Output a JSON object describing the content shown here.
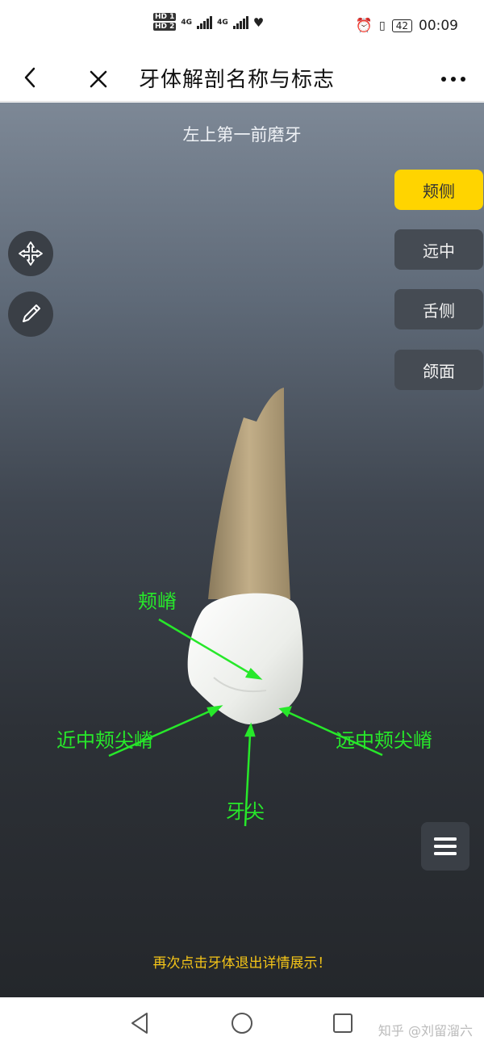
{
  "status_bar": {
    "hd1": "HD 1",
    "hd2": "HD 2",
    "net1": "4G",
    "net2": "4G",
    "battery": "42",
    "time": "00:09"
  },
  "header": {
    "title": "牙体解剖名称与标志",
    "icons": [
      "back-icon",
      "close-icon",
      "more-icon"
    ]
  },
  "viewer": {
    "tooth_name": "左上第一前磨牙",
    "view_buttons": [
      {
        "label": "颊侧",
        "active": true
      },
      {
        "label": "远中",
        "active": false
      },
      {
        "label": "舌侧",
        "active": false
      },
      {
        "label": "颌面",
        "active": false
      }
    ],
    "annotations": {
      "buccal_ridge": "颊嵴",
      "mesial_cusp_ridge": "近中颊尖嵴",
      "distal_cusp_ridge": "远中颊尖嵴",
      "cusp_tip": "牙尖"
    },
    "annotation_color": "#27e82a",
    "hint": "再次点击牙体退出详情展示！",
    "accent_color": "#ffd400"
  },
  "watermark": "知乎 @刘留溜六"
}
